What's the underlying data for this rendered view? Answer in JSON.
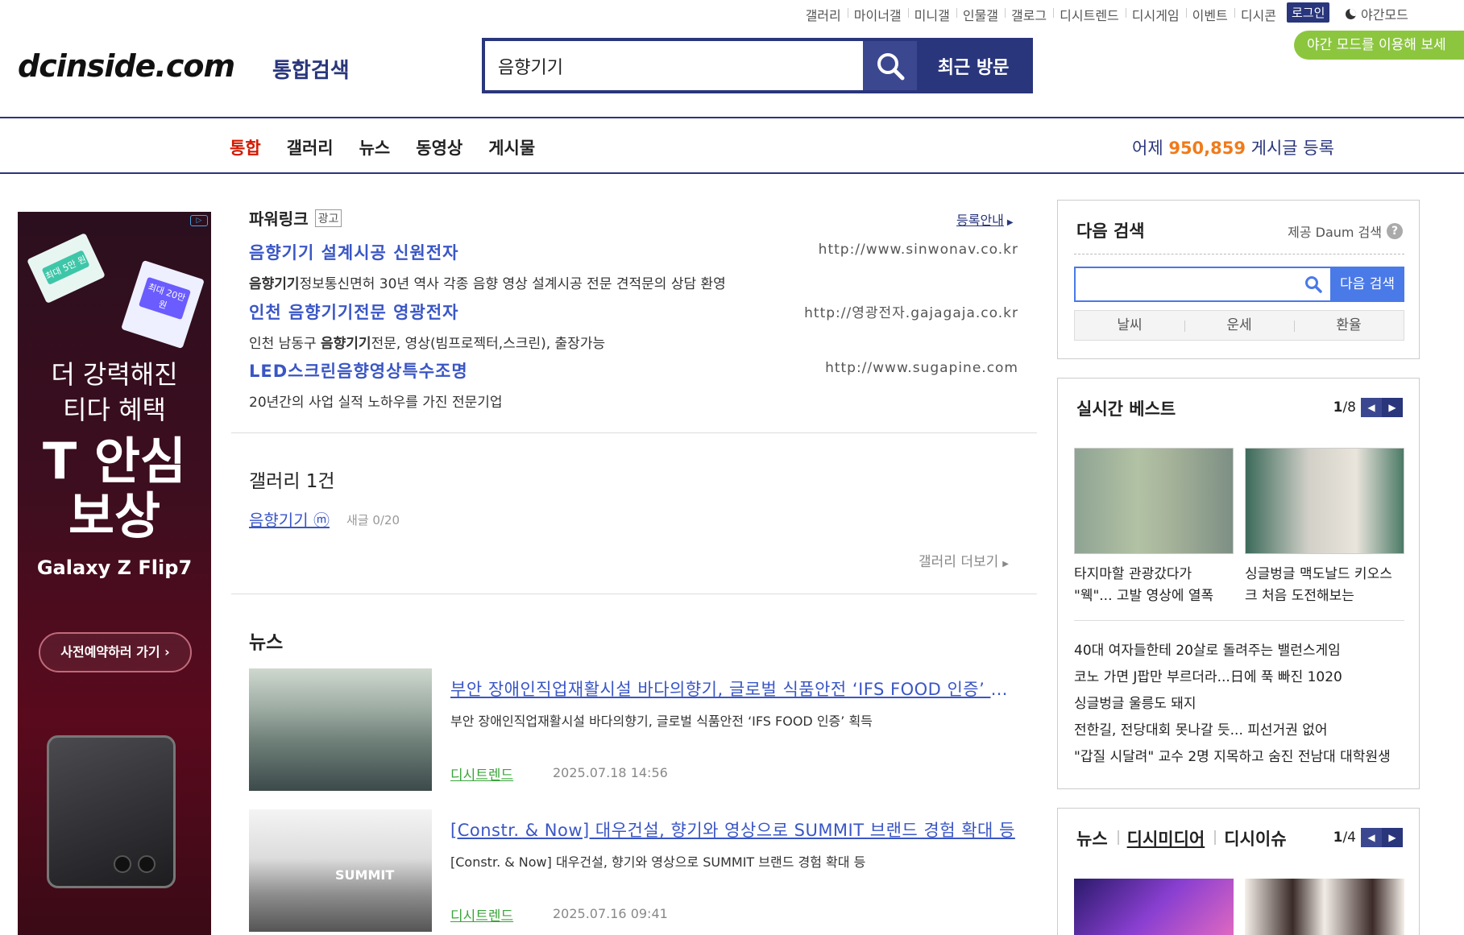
{
  "topnav": {
    "items": [
      "갤러리",
      "마이너갤",
      "미니갤",
      "인물갤",
      "갤로그",
      "디시트렌드",
      "디시게임",
      "이벤트",
      "디시콘"
    ],
    "login": "로그인",
    "night_mode": "야간모드",
    "tooltip": "야간 모드를 이용해 보세"
  },
  "header": {
    "logo": "dcinside.com",
    "logo_sub": "통합검색",
    "search_value": "음향기기",
    "recent_button": "최근 방문"
  },
  "tabs": [
    "통합",
    "갤러리",
    "뉴스",
    "동영상",
    "게시물"
  ],
  "stats": {
    "prefix": "어제",
    "count": "950,859",
    "suffix": "게시글 등록"
  },
  "ad": {
    "card1": "최대 5만 원",
    "card2": "최대 20만 원",
    "line1": "더 강력해진",
    "line2": "티다 혜택",
    "big1": "T 안심",
    "big2": "보상",
    "product": "Galaxy Z Flip7",
    "cta": "사전예약하러 가기 ›"
  },
  "powerlink": {
    "title": "파워링크",
    "ad_tag": "광고",
    "register": "등록안내",
    "items": [
      {
        "title": "음향기기 설계시공 신원전자",
        "url": "http://www.sinwonav.co.kr",
        "desc_bold": "음향기기",
        "desc": "정보통신면허 30년 역사 각종 음향 영상 설계시공 전문 견적문의 상담 환영"
      },
      {
        "title": "인천 음향기기전문 영광전자",
        "url": "http://영광전자.gajagaja.co.kr",
        "desc_pre": "인천 남동구 ",
        "desc_bold": "음향기기",
        "desc": "전문, 영상(빔프로젝터,스크린), 출장가능"
      },
      {
        "title": "LED스크린음향영상특수조명",
        "url": "http://www.sugapine.com",
        "desc": "20년간의 사업 실적 노하우를 가진 전문기업"
      }
    ]
  },
  "gallery": {
    "title": "갤러리 1건",
    "link": "음향기기 ⓜ",
    "new_posts": "새글 0/20",
    "more": "갤러리 더보기"
  },
  "news": {
    "title": "뉴스",
    "items": [
      {
        "title": "부안 장애인직업재활시설 바다의향기, 글로벌 식품안전 ‘IFS FOOD 인증’ 획득",
        "summary": "부안 장애인직업재활시설 바다의향기, 글로벌 식품안전 ‘IFS FOOD 인증’ 획득",
        "source": "디시트렌드",
        "date": "2025.07.18 14:56"
      },
      {
        "title": "[Constr. & Now] 대우건설, 향기와 영상으로 SUMMIT 브랜드 경험 확대 등",
        "summary": "[Constr. & Now] 대우건설, 향기와 영상으로 SUMMIT 브랜드 경험 확대 등",
        "source": "디시트렌드",
        "date": "2025.07.16 09:41",
        "thumb_text": "SUMMIT"
      }
    ]
  },
  "daum": {
    "title": "다음 검색",
    "provider": "제공 Daum 검색",
    "help": "?",
    "button": "다음 검색",
    "quick": [
      "날씨",
      "운세",
      "환율"
    ]
  },
  "realtime": {
    "title": "실시간 베스트",
    "page": "1",
    "total": "/8",
    "captions": [
      "타지마할 관광갔다가 \"웩\"... 고발 영상에 열폭",
      "싱글벙글 맥도날드 키오스크 처음 도전해보는"
    ],
    "list": [
      "40대 여자들한테 20살로 돌려주는 밸런스게임",
      "코노 가면 J팝만 부르더라...日에 푹 빠진 1020",
      "싱글벙글 울릉도 돼지",
      "전한길, 전당대회 못나갈 듯... 피선거권 없어",
      "\"갑질 시달려\" 교수 2명 지목하고 숨진 전남대 대학원생"
    ]
  },
  "news_box": {
    "tabs": [
      "뉴스",
      "디시미디어",
      "디시이슈"
    ],
    "page": "1",
    "total": "/4"
  }
}
